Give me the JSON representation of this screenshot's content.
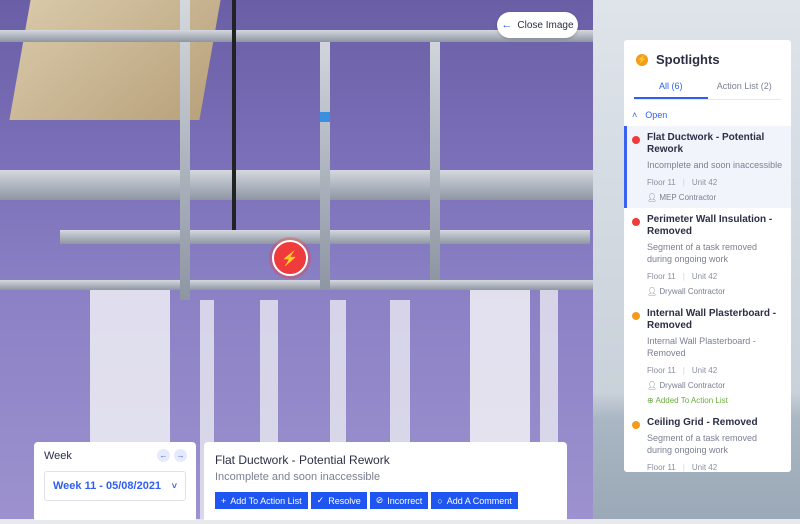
{
  "viewer": {
    "close_label": "Close Image"
  },
  "spotlights": {
    "title": "Spotlights",
    "tabs": [
      {
        "label": "All (6)"
      },
      {
        "label": "Action List (2)"
      }
    ],
    "section": "Open",
    "items": [
      {
        "title": "Flat Ductwork - Potential Rework",
        "desc": "Incomplete and soon inaccessible",
        "floor": "Floor 11",
        "unit": "Unit 42",
        "contractor": "MEP Contractor",
        "color": "#ef3b3b"
      },
      {
        "title": "Perimeter Wall Insulation - Removed",
        "desc": "Segment of a task removed during ongoing work",
        "floor": "Floor 11",
        "unit": "Unit 42",
        "contractor": "Drywall Contractor",
        "color": "#ef3b3b"
      },
      {
        "title": "Internal Wall Plasterboard - Removed",
        "desc": "Internal Wall Plasterboard - Removed",
        "floor": "Floor 11",
        "unit": "Unit 42",
        "contractor": "Drywall Contractor",
        "status": "Added To Action List",
        "color": "#f59b1c"
      },
      {
        "title": "Ceiling Grid - Removed",
        "desc": "Segment of a task removed during ongoing work",
        "floor": "Floor 11",
        "unit": "Unit 42",
        "color": "#f59b1c"
      }
    ]
  },
  "week": {
    "label": "Week",
    "selected": "Week 11 - 05/08/2021"
  },
  "detail": {
    "title": "Flat Ductwork - Potential Rework",
    "desc": "Incomplete and soon inaccessible",
    "actions": [
      "Add To Action List",
      "Resolve",
      "Incorrect",
      "Add A Comment"
    ]
  }
}
